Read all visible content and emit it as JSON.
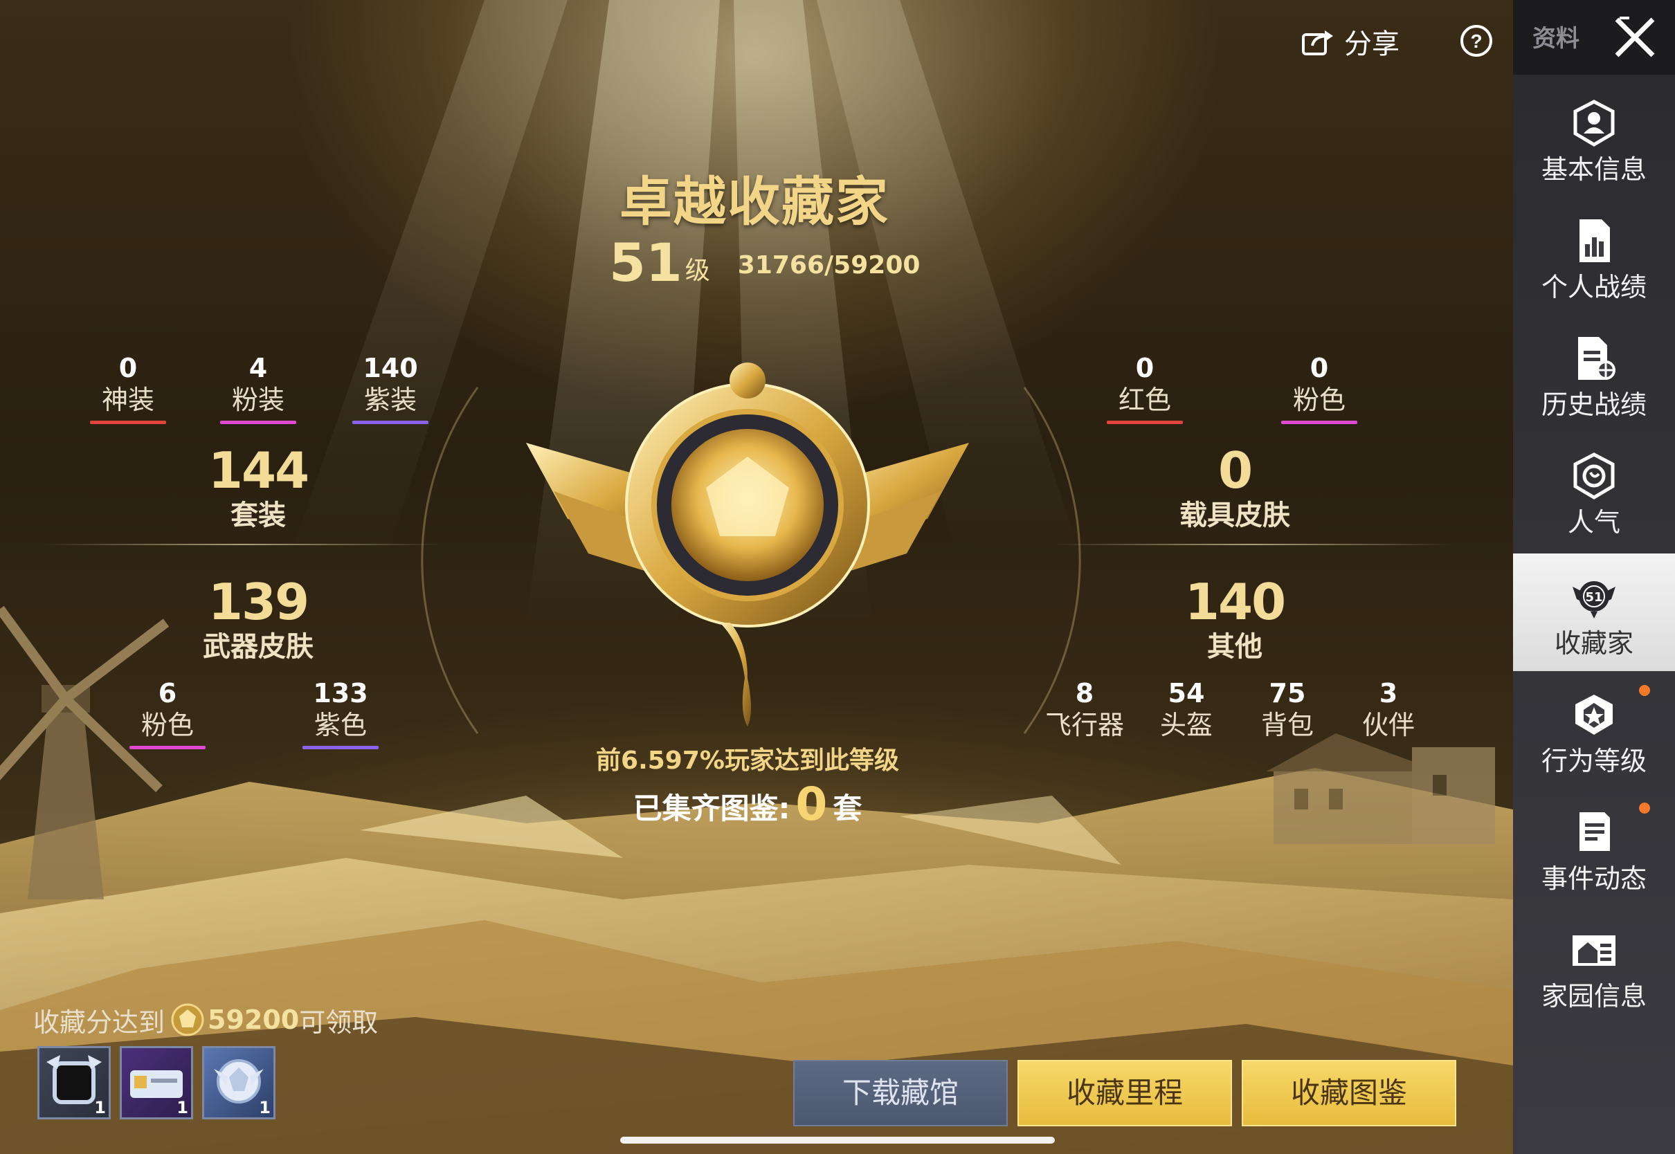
{
  "header": {
    "share_label": "分享",
    "help_icon": "question-circle-icon"
  },
  "collector": {
    "title": "卓越收藏家",
    "level": "51",
    "level_unit": "级",
    "points": "31766/59200",
    "rank_text": "前6.597%玩家达到此等级",
    "completed_label": "已集齐图鉴:",
    "completed_value": "0",
    "completed_unit": "套"
  },
  "left_stats": {
    "top": [
      {
        "value": "0",
        "label": "神装",
        "color": "#e0443a"
      },
      {
        "value": "4",
        "label": "粉装",
        "color": "#e04ad0"
      },
      {
        "value": "140",
        "label": "紫装",
        "color": "#8a63e8"
      }
    ],
    "outfits": {
      "value": "144",
      "label": "套装"
    },
    "weapons": {
      "value": "139",
      "label": "武器皮肤"
    },
    "bottom": [
      {
        "value": "6",
        "label": "粉色",
        "color": "#e04ad0"
      },
      {
        "value": "133",
        "label": "紫色",
        "color": "#8a63e8"
      }
    ]
  },
  "right_stats": {
    "top": [
      {
        "value": "0",
        "label": "红色",
        "color": "#e0443a"
      },
      {
        "value": "0",
        "label": "粉色",
        "color": "#e04ad0"
      }
    ],
    "vehicles": {
      "value": "0",
      "label": "载具皮肤"
    },
    "others": {
      "value": "140",
      "label": "其他"
    },
    "bottom": [
      {
        "value": "8",
        "label": "飞行器"
      },
      {
        "value": "54",
        "label": "头盔"
      },
      {
        "value": "75",
        "label": "背包"
      },
      {
        "value": "3",
        "label": "伙伴"
      }
    ]
  },
  "reward": {
    "prefix": "收藏分达到",
    "points": "59200",
    "suffix": "可领取",
    "items": [
      {
        "count": "1"
      },
      {
        "count": "1"
      },
      {
        "count": "1"
      }
    ]
  },
  "buttons": {
    "download": "下载藏馆",
    "milestones": "收藏里程",
    "catalog": "收藏图鉴"
  },
  "sidebar": {
    "header": "资料",
    "items": [
      {
        "label": "基本信息",
        "icon": "profile-icon"
      },
      {
        "label": "个人战绩",
        "icon": "stats-doc-icon"
      },
      {
        "label": "历史战绩",
        "icon": "history-doc-icon"
      },
      {
        "label": "人气",
        "icon": "rose-icon"
      },
      {
        "label": "收藏家",
        "icon": "collector-badge-icon",
        "badge": "51"
      },
      {
        "label": "行为等级",
        "icon": "behavior-badge-icon"
      },
      {
        "label": "事件动态",
        "icon": "event-doc-icon"
      },
      {
        "label": "家园信息",
        "icon": "home-icon"
      }
    ]
  },
  "colors": {
    "gold": "#f0d48a",
    "accent_orange": "#f47a2a"
  }
}
